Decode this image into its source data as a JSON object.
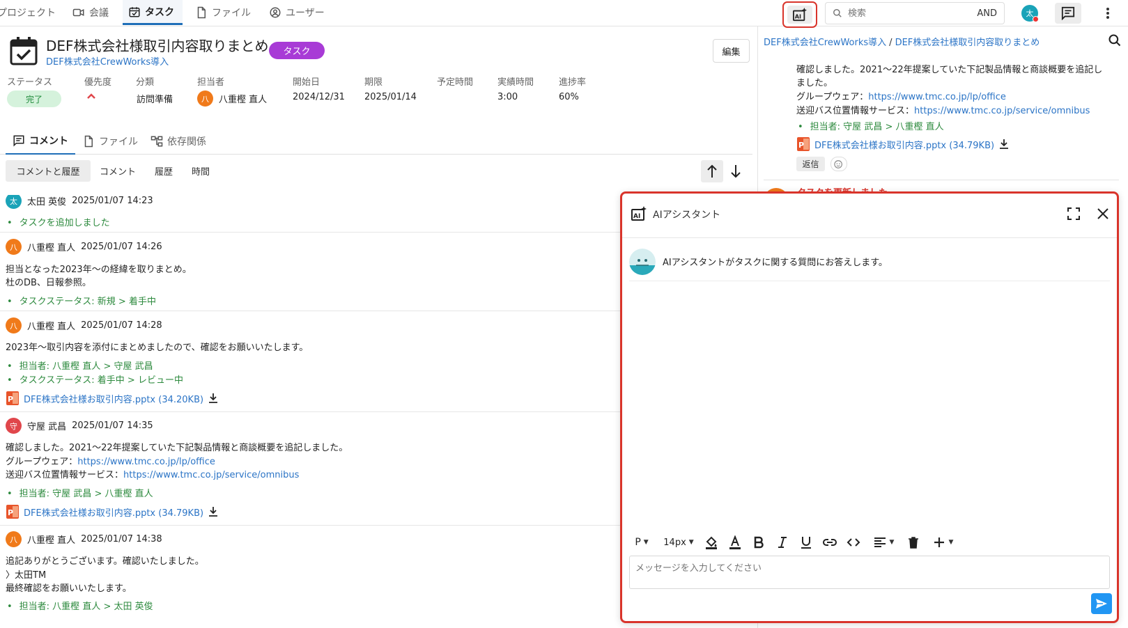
{
  "nav": {
    "tabs": [
      {
        "label": "プロジェクト",
        "icon": "folder-icon"
      },
      {
        "label": "会議",
        "icon": "video-icon"
      },
      {
        "label": "タスク",
        "icon": "calendar-check-icon"
      },
      {
        "label": "ファイル",
        "icon": "file-icon"
      },
      {
        "label": "ユーザー",
        "icon": "user-circle-icon"
      }
    ],
    "active_tab": "タスク",
    "search_placeholder": "検索",
    "search_mode": "AND",
    "user_avatar": "太"
  },
  "task": {
    "title": "DEF株式会社様取引内容取りまとめ",
    "type_badge": "タスク",
    "project_link": "DEF株式会社CrewWorks導入",
    "edit_label": "編集",
    "meta_labels": {
      "status": "ステータス",
      "priority": "優先度",
      "category": "分類",
      "assignee": "担当者",
      "start": "開始日",
      "due": "期限",
      "planned": "予定時間",
      "actual": "実績時間",
      "progress": "進捗率"
    },
    "status": "完了",
    "category": "訪問準備",
    "assignee_initial": "八",
    "assignee": "八重樫 直人",
    "start_date": "2024/12/31",
    "due_date": "2025/01/14",
    "planned_time": "",
    "actual_time": "3:00",
    "progress": "60%"
  },
  "tabs": {
    "comment": "コメント",
    "file": "ファイル",
    "dependency": "依存関係"
  },
  "filters": [
    "コメントと履歴",
    "コメント",
    "履歴",
    "時間"
  ],
  "feed": [
    {
      "initial": "太",
      "user": "太田 英俊",
      "time": "2025/01/07 14:23",
      "lines": [],
      "bullets": [
        "タスクを追加しました"
      ]
    },
    {
      "initial": "八",
      "user": "八重樫 直人",
      "time": "2025/01/07 14:26",
      "lines": [
        "担当となった2023年～の経緯を取りまとめ。",
        "杜のDB、日報参照。"
      ],
      "bullets": [
        "タスクステータス: 新規 > 着手中"
      ]
    },
    {
      "initial": "八",
      "user": "八重樫 直人",
      "time": "2025/01/07 14:28",
      "lines": [
        "2023年～取引内容を添付にまとめましたので、確認をお願いいたします。"
      ],
      "bullets": [
        "担当者: 八重樫 直人 > 守屋 武昌",
        "タスクステータス: 着手中 > レビュー中"
      ],
      "file": "DFE株式会社様お取引内容.pptx (34.20KB)"
    },
    {
      "initial": "守",
      "user": "守屋 武昌",
      "time": "2025/01/07 14:35",
      "lines": [
        "確認しました。2021～22年提案していた下記製品情報と商談概要を追記しました。"
      ],
      "link_lines": [
        {
          "prefix": "グループウェア：",
          "url": "https://www.tmc.co.jp/lp/office"
        },
        {
          "prefix": "送迎バス位置情報サービス：",
          "url": "https://www.tmc.co.jp/service/omnibus"
        }
      ],
      "bullets": [
        "担当者: 守屋 武昌 > 八重樫 直人"
      ],
      "file": "DFE株式会社様お取引内容.pptx (34.79KB)"
    },
    {
      "initial": "八",
      "user": "八重樫 直人",
      "time": "2025/01/07 14:38",
      "lines": [
        "追記ありがとうございます。確認いたしました。",
        "〉太田TM",
        "最終確認をお願いいたします。"
      ],
      "bullets": [
        "担当者: 八重樫 直人 > 太田 英俊"
      ]
    }
  ],
  "right": {
    "breadcrumb_project": "DEF株式会社CrewWorks導入",
    "breadcrumb_task": "DEF株式会社様取引内容取りまとめ",
    "text_lines": [
      "確認しました。2021～22年提案していた下記製品情報と商談概要を追記し",
      "ました。"
    ],
    "link_lines": [
      {
        "prefix": "グループウェア：",
        "url": "https://www.tmc.co.jp/lp/office"
      },
      {
        "prefix": "送迎バス位置情報サービス：",
        "url": "https://www.tmc.co.jp/service/omnibus"
      }
    ],
    "bullet": "担当者: 守屋 武昌 > 八重樫 直人",
    "file": "DFE株式会社様お取引内容.pptx (34.79KB)",
    "reply_label": "返信",
    "peek_text": "タスクを更新しました。"
  },
  "ai": {
    "title": "AIアシスタント",
    "greeting": "AIアシスタントがタスクに関する質問にお答えします。",
    "paragraph_label": "P",
    "font_size": "14px",
    "input_placeholder": "メッセージを入力してください"
  },
  "colors": {
    "accent": "#1f6fb8",
    "link": "#2b74c6",
    "highlight": "#d9342b",
    "badge": "#a83bd6",
    "status_done_bg": "#d5f2dc",
    "history_green": "#2d8a3e"
  }
}
